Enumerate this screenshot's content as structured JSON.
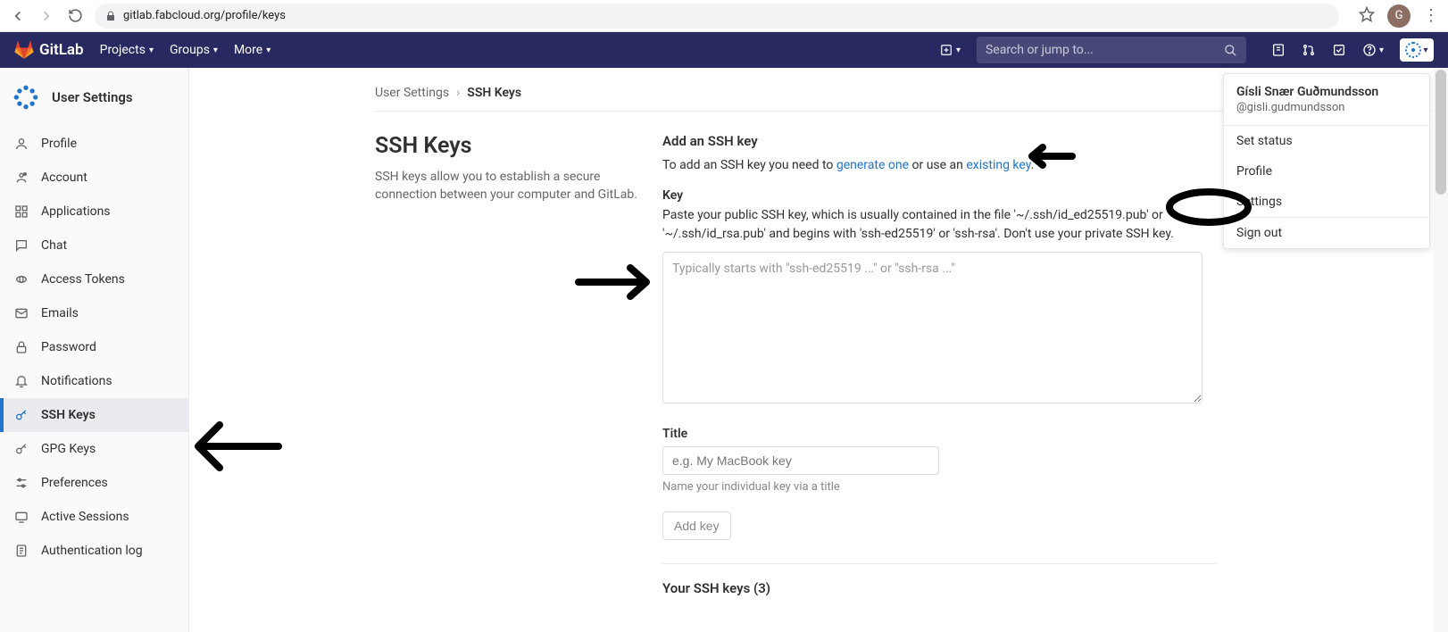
{
  "browser": {
    "url": "gitlab.fabcloud.org/profile/keys",
    "avatar_letter": "G"
  },
  "topnav": {
    "brand": "GitLab",
    "links": [
      "Projects",
      "Groups",
      "More"
    ],
    "search_placeholder": "Search or jump to..."
  },
  "sidebar": {
    "title": "User Settings",
    "items": [
      {
        "label": "Profile",
        "icon": "user"
      },
      {
        "label": "Account",
        "icon": "account"
      },
      {
        "label": "Applications",
        "icon": "apps"
      },
      {
        "label": "Chat",
        "icon": "chat"
      },
      {
        "label": "Access Tokens",
        "icon": "token"
      },
      {
        "label": "Emails",
        "icon": "mail"
      },
      {
        "label": "Password",
        "icon": "lock"
      },
      {
        "label": "Notifications",
        "icon": "bell"
      },
      {
        "label": "SSH Keys",
        "icon": "key"
      },
      {
        "label": "GPG Keys",
        "icon": "key"
      },
      {
        "label": "Preferences",
        "icon": "prefs"
      },
      {
        "label": "Active Sessions",
        "icon": "session"
      },
      {
        "label": "Authentication log",
        "icon": "log"
      }
    ],
    "active_index": 8
  },
  "breadcrumb": {
    "parent": "User Settings",
    "current": "SSH Keys"
  },
  "section": {
    "title": "SSH Keys",
    "subtitle": "SSH keys allow you to establish a secure connection between your computer and GitLab."
  },
  "form": {
    "add_heading": "Add an SSH key",
    "add_text_pre": "To add an SSH key you need to ",
    "link_generate": "generate one",
    "add_text_mid": " or use an ",
    "link_existing": "existing key",
    "add_text_post": ".",
    "key_label": "Key",
    "key_help": "Paste your public SSH key, which is usually contained in the file '~/.ssh/id_ed25519.pub' or '~/.ssh/id_rsa.pub' and begins with 'ssh-ed25519' or 'ssh-rsa'. Don't use your private SSH key.",
    "key_placeholder": "Typically starts with \"ssh-ed25519 ...\" or \"ssh-rsa ...\"",
    "title_label": "Title",
    "title_placeholder": "e.g. My MacBook key",
    "title_hint": "Name your individual key via a title",
    "add_button": "Add key",
    "your_keys_label": "Your SSH keys (3)"
  },
  "usermenu": {
    "name": "Gísli Snær Guðmundsson",
    "handle": "@gisli.gudmundsson",
    "items": [
      "Set status",
      "Profile",
      "Settings",
      "Sign out"
    ]
  }
}
